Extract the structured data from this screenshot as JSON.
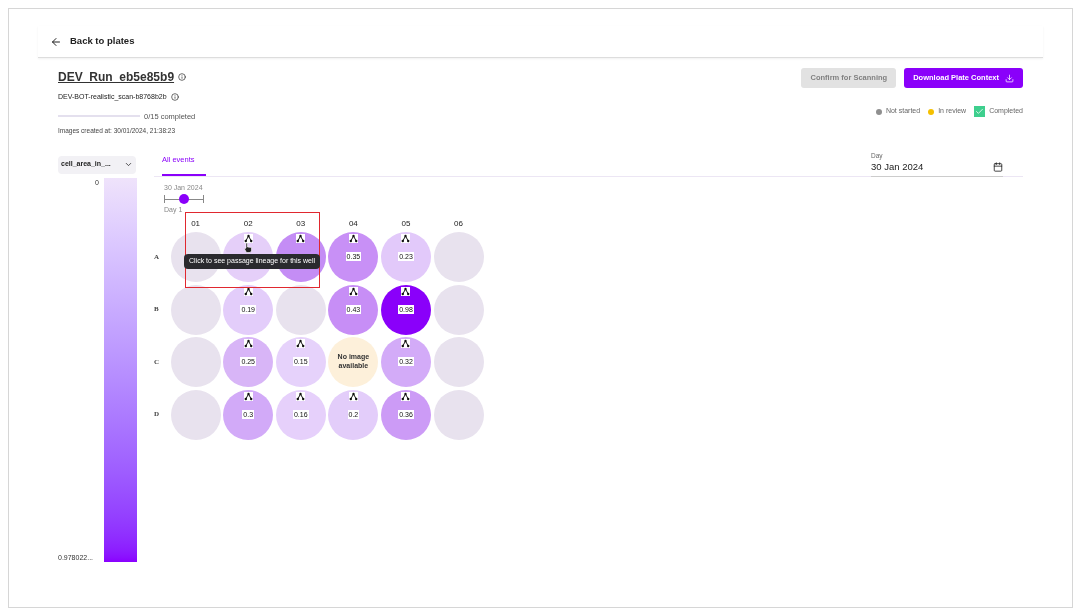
{
  "back_link": "Back to plates",
  "plate": {
    "title": "DEV_Run_eb5e85b9",
    "scan_name": "DEV-BOT-realistic_scan-b8768b2b",
    "progress": {
      "level": 0,
      "label": "0/15 completed"
    },
    "images_created": "Images created at: 30/01/2024, 21:38:23"
  },
  "buttons": [
    {
      "label": "Confirm for Scanning",
      "disabled": true
    },
    {
      "label": "Download Plate Context",
      "disabled": false
    }
  ],
  "legend": [
    {
      "label": "Not started",
      "kind": "dot",
      "color": "#8f8f8f"
    },
    {
      "label": "In review",
      "kind": "dot",
      "color": "#f5c000"
    },
    {
      "label": "Completed",
      "kind": "check",
      "color": "#3ecf8e"
    }
  ],
  "metric_select": {
    "value": "cell_area_in_..."
  },
  "color_scale": {
    "min": "0",
    "max": "0.978022..."
  },
  "tabs": [
    {
      "label": "All events",
      "selected": true
    }
  ],
  "day_field": {
    "label": "Day",
    "value": "30 Jan 2024"
  },
  "timeline": {
    "date": "30 Jan 2024",
    "day": "Day 1",
    "level": 0.5
  },
  "plate_grid": {
    "columns": [
      "01",
      "02",
      "03",
      "04",
      "05",
      "06"
    ],
    "rows": [
      {
        "label": "A",
        "wells": [
          {
            "kind": "empty",
            "color": "#e8e2ee"
          },
          {
            "kind": "measured",
            "color": "#e5cff9",
            "lineage": true
          },
          {
            "kind": "measured",
            "color": "#c48df5",
            "lineage": true
          },
          {
            "kind": "measured",
            "color": "#c890f6",
            "lineage": true,
            "value": "0.35"
          },
          {
            "kind": "measured",
            "color": "#e2c9fa",
            "lineage": true,
            "value": "0.23"
          },
          {
            "kind": "empty",
            "color": "#e8e2ee"
          }
        ]
      },
      {
        "label": "B",
        "wells": [
          {
            "kind": "empty",
            "color": "#e8e2ee"
          },
          {
            "kind": "measured",
            "color": "#e3cdfa",
            "lineage": true,
            "value": "0.19"
          },
          {
            "kind": "empty",
            "color": "#e8e2ee"
          },
          {
            "kind": "measured",
            "color": "#c78ef6",
            "lineage": true,
            "value": "0.43"
          },
          {
            "kind": "measured",
            "color": "#8a00fa",
            "lineage": true,
            "value": "0.98"
          },
          {
            "kind": "empty",
            "color": "#e8e2ee"
          }
        ]
      },
      {
        "label": "C",
        "wells": [
          {
            "kind": "empty",
            "color": "#e8e2ee"
          },
          {
            "kind": "measured",
            "color": "#d8b5f7",
            "lineage": true,
            "value": "0.25"
          },
          {
            "kind": "measured",
            "color": "#e6d2fb",
            "lineage": true,
            "value": "0.15"
          },
          {
            "kind": "no_image",
            "color": "#fdf0da",
            "value": "No image available"
          },
          {
            "kind": "measured",
            "color": "#d3abf8",
            "lineage": true,
            "value": "0.32"
          },
          {
            "kind": "empty",
            "color": "#e8e2ee"
          }
        ]
      },
      {
        "label": "D",
        "wells": [
          {
            "kind": "empty",
            "color": "#e8e2ee"
          },
          {
            "kind": "measured",
            "color": "#d2aaf8",
            "lineage": true,
            "value": "0.3"
          },
          {
            "kind": "measured",
            "color": "#e6d0fb",
            "lineage": true,
            "value": "0.16"
          },
          {
            "kind": "measured",
            "color": "#e3cdfa",
            "lineage": true,
            "value": "0.2"
          },
          {
            "kind": "measured",
            "color": "#cc9bf6",
            "lineage": true,
            "value": "0.36"
          },
          {
            "kind": "empty",
            "color": "#e8e2ee"
          }
        ]
      }
    ]
  },
  "tooltip": {
    "text": "Click to see passage lineage for this well"
  }
}
